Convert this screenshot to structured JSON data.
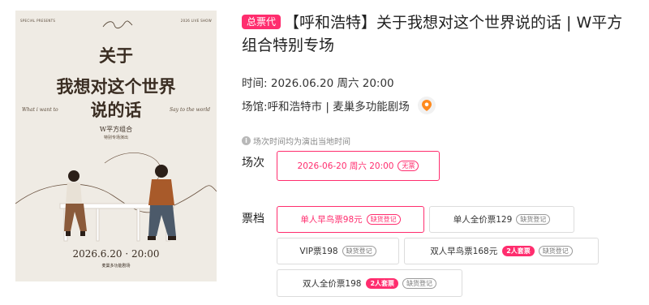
{
  "poster": {
    "top_left": "SPECIAL PRESENTS",
    "top_right": "2026 LIVE SHOW",
    "title_line1": "关于",
    "title_line2": "我想对这个世界",
    "title_line3": "说的话",
    "script_left": "What i want to",
    "script_right": "Say to the world",
    "subtitle1": "W平方组合",
    "subtitle2": "特别专场演出",
    "date": "2026.6.20 · 20:00",
    "venue": "麦巢多功能剧场"
  },
  "event": {
    "agent_badge": "总票代",
    "title": "【呼和浩特】关于我想对这个世界说的话 | W平方组合特别专场",
    "time_label": "时间:",
    "time_value": "2026.06.20 周六 20:00",
    "venue_label": "场馆:",
    "venue_value": "呼和浩特市 | 麦巢多功能剧场",
    "location_icon": "location-pin-icon",
    "notice": "场次时间均为演出当地时间"
  },
  "sessions": {
    "label": "场次",
    "items": [
      {
        "text": "2026-06-20 周六 20:00",
        "tag": "无票"
      }
    ]
  },
  "tickets": {
    "label": "票档",
    "items": [
      {
        "name": "单人早鸟票98元",
        "badge": "",
        "tag": "缺货登记"
      },
      {
        "name": "单人全价票129",
        "badge": "",
        "tag": "缺货登记"
      },
      {
        "name": "VIP票198",
        "badge": "",
        "tag": "缺货登记"
      },
      {
        "name": "双人早鸟票168元",
        "badge": "2人套票",
        "tag": "缺货登记"
      },
      {
        "name": "双人全价票198",
        "badge": "2人套票",
        "tag": "缺货登记"
      }
    ]
  },
  "colors": {
    "accent": "#ff2d6e",
    "poster_bg": "#efebe4"
  }
}
